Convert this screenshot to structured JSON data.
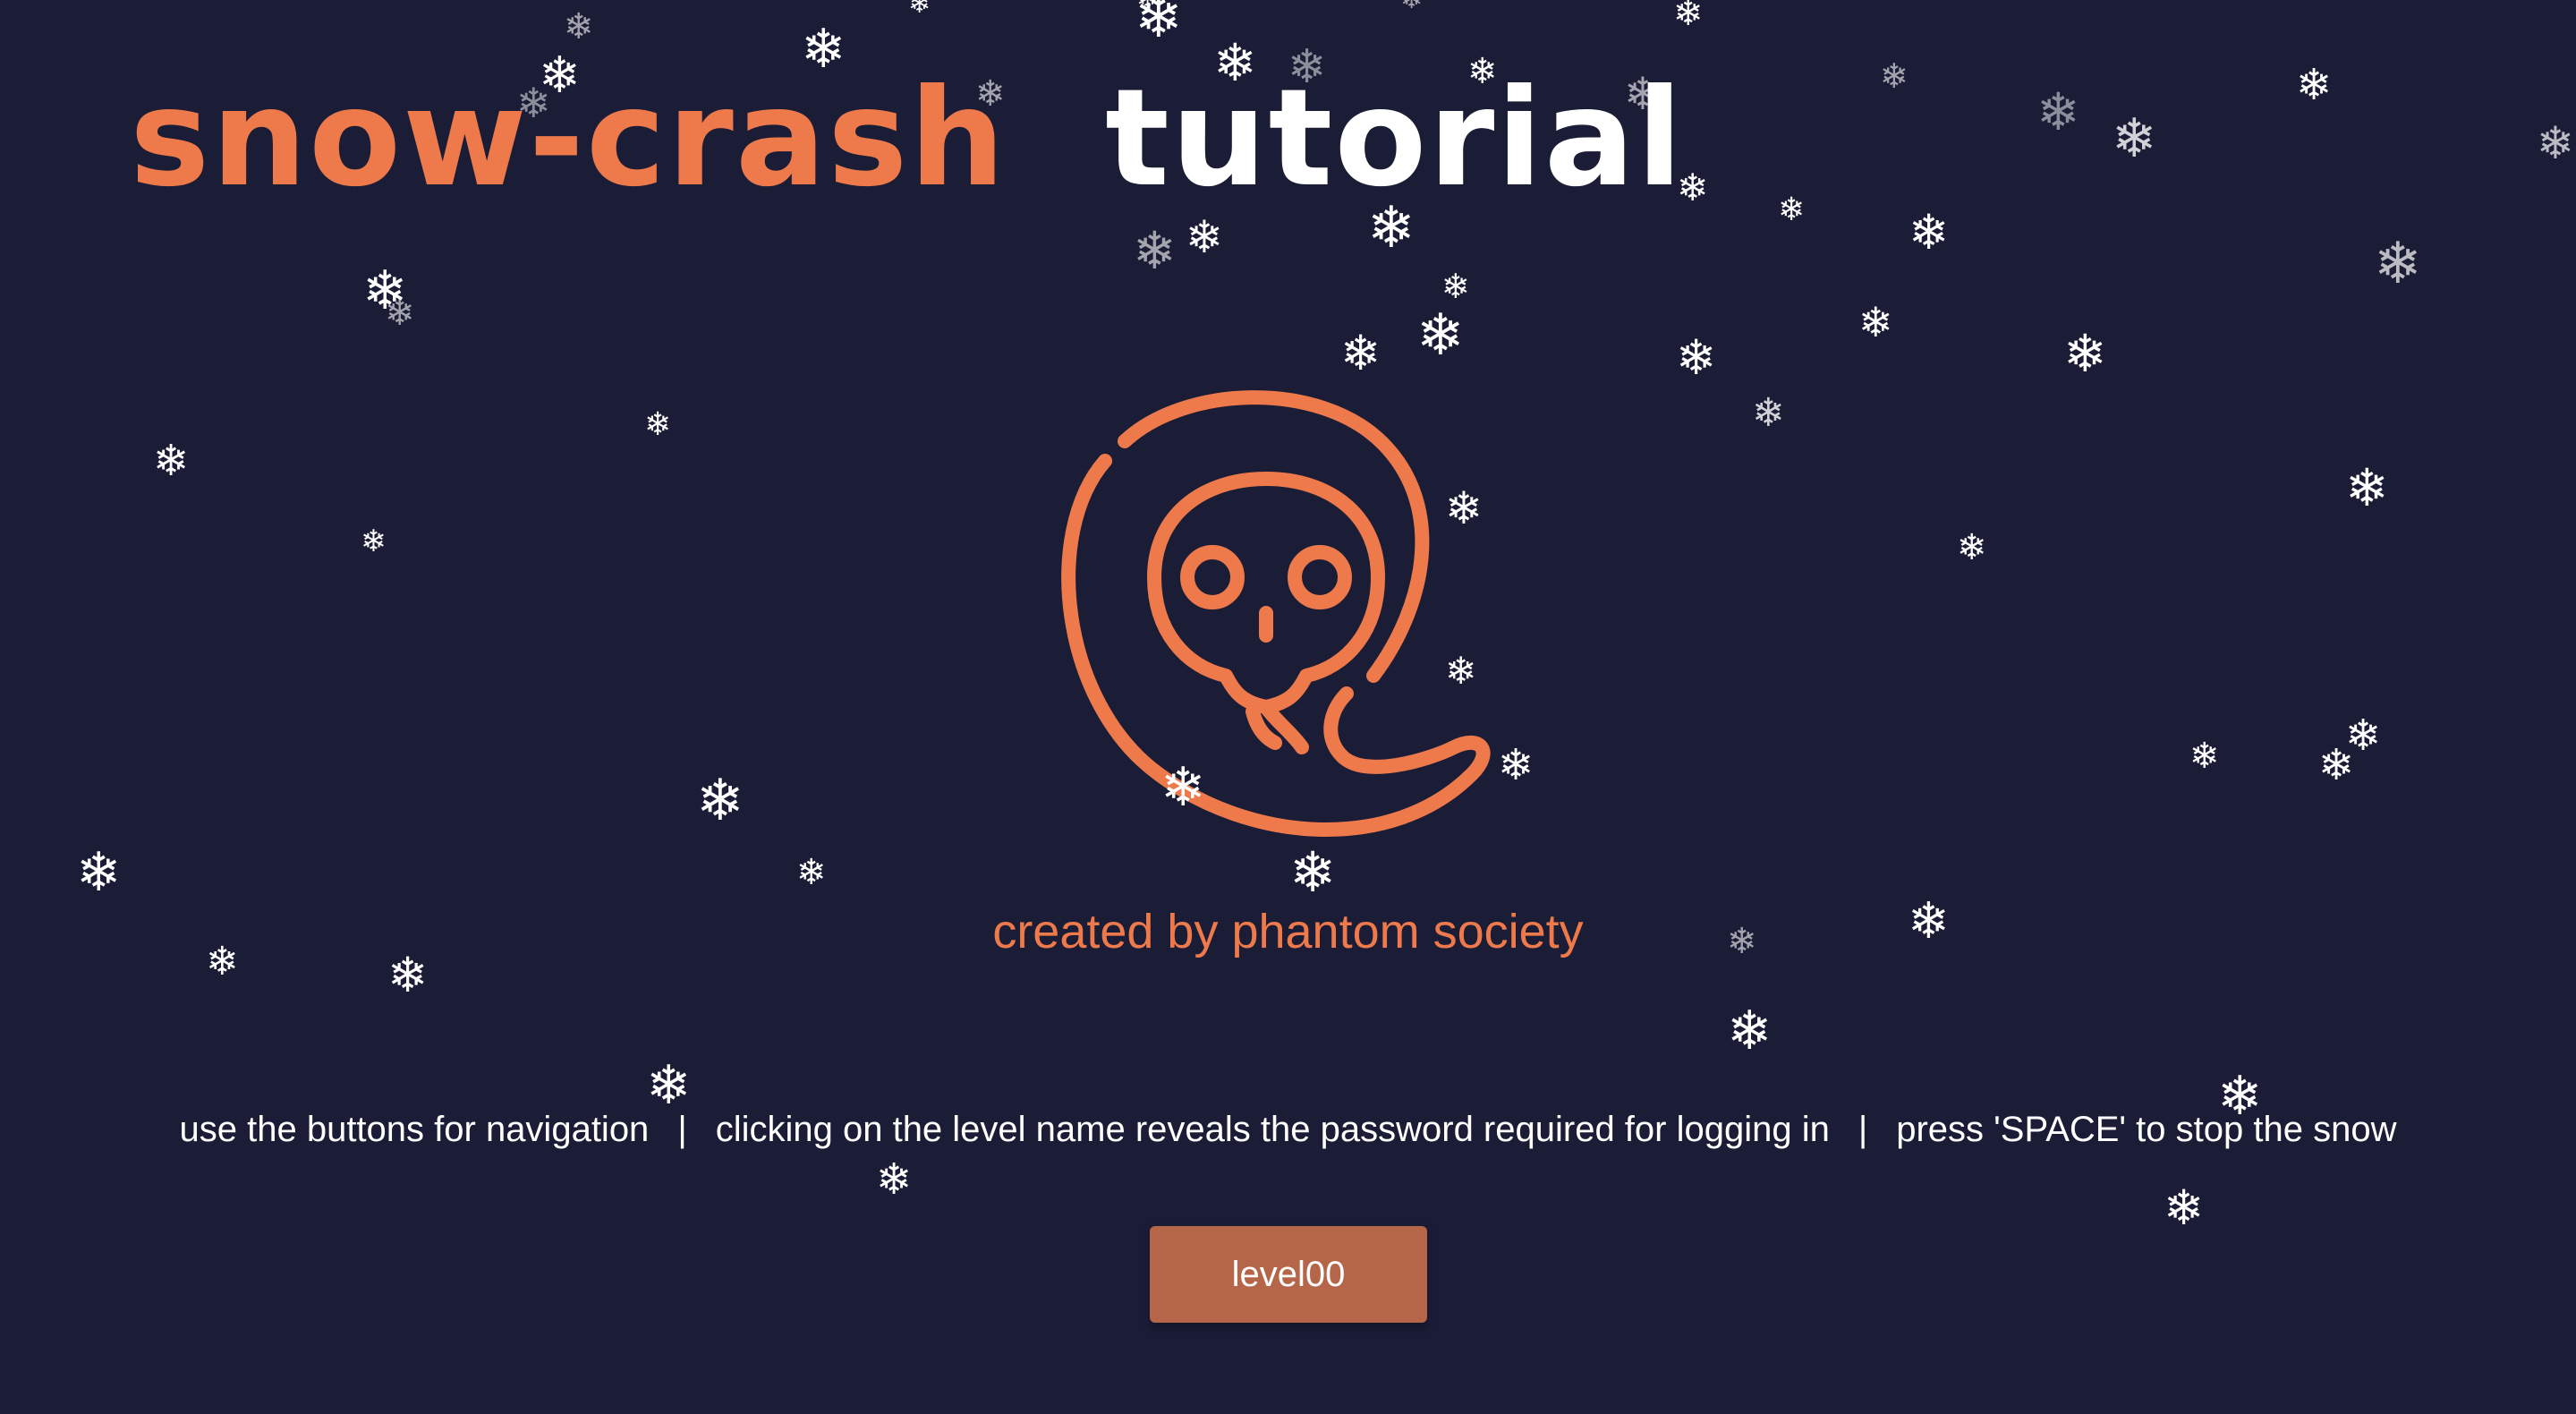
{
  "header": {
    "brand": "snow-crash",
    "page_title": "tutorial"
  },
  "credit": "created by phantom society",
  "help": {
    "hint_navigation": "use the buttons for navigation",
    "hint_reveal": "clicking on the level name reveals the password required for logging in",
    "hint_snow": "press 'SPACE' to stop the snow",
    "separator": "|"
  },
  "level_button": {
    "label": "level00"
  },
  "colors": {
    "background": "#1b1d37",
    "accent": "#ee7a4b",
    "button": "#b56548",
    "text": "#ffffff"
  },
  "icons": {
    "logo": "skull-ghost-logo-icon",
    "snowflake": "snowflake-icon"
  }
}
